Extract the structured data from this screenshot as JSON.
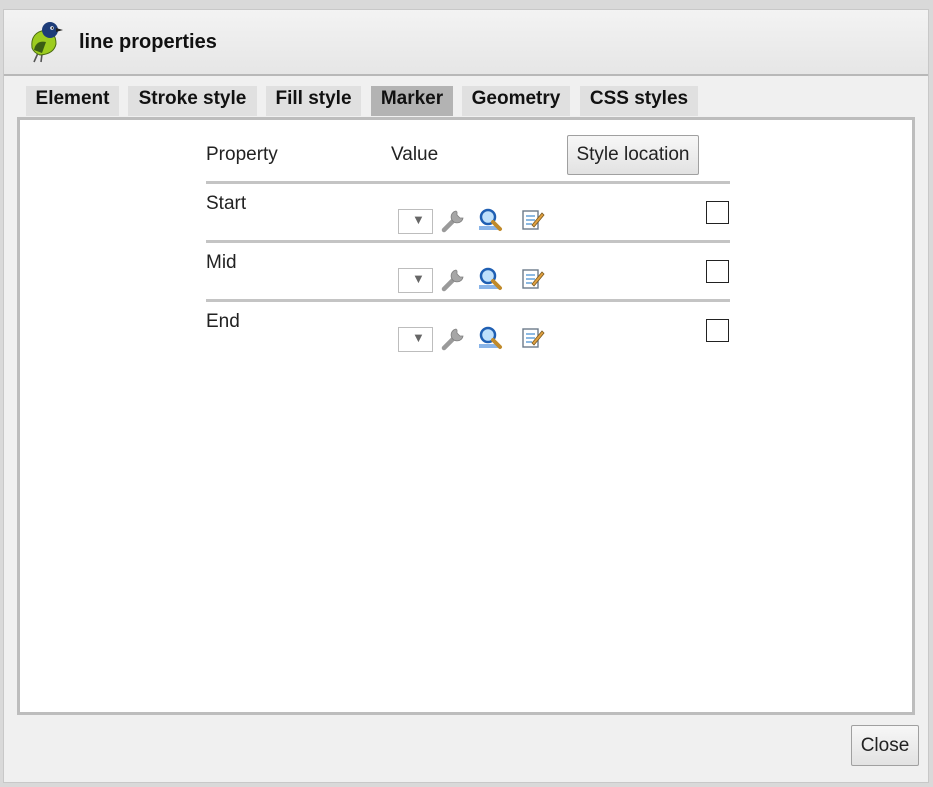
{
  "dialog": {
    "title": "line properties"
  },
  "tabs": [
    {
      "label": "Element",
      "active": false
    },
    {
      "label": "Stroke style",
      "active": false
    },
    {
      "label": "Fill style",
      "active": false
    },
    {
      "label": "Marker",
      "active": true
    },
    {
      "label": "Geometry",
      "active": false
    },
    {
      "label": "CSS styles",
      "active": false
    }
  ],
  "table": {
    "header_property": "Property",
    "header_value": "Value",
    "style_location_button": "Style location",
    "rows": [
      {
        "label": "Start",
        "checked": false
      },
      {
        "label": "Mid",
        "checked": false
      },
      {
        "label": "End",
        "checked": false
      }
    ]
  },
  "footer": {
    "close_label": "Close"
  },
  "icons": {
    "app": "bird-icon",
    "dropdown": "dropdown-arrow-icon",
    "wrench": "wrench-icon",
    "search": "magnifier-icon",
    "edit": "edit-note-icon"
  },
  "colors": {
    "active_tab": "#b3b3b3",
    "inactive_tab": "#e0e0e0",
    "panel_border": "#bdbdbd"
  }
}
